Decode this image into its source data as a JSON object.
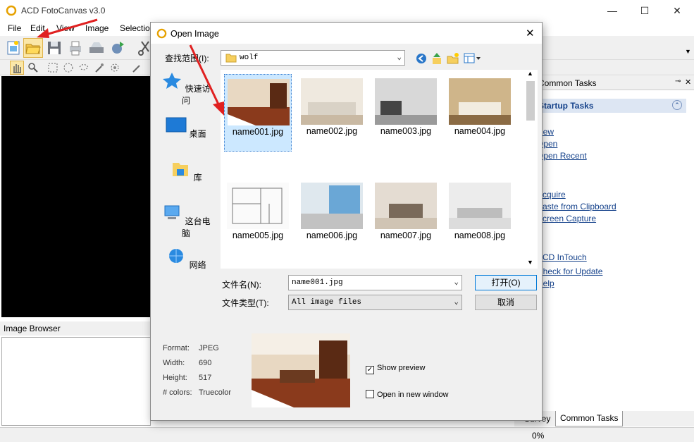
{
  "app": {
    "title": "ACD FotoCanvas v3.0",
    "minimize": "—",
    "maximize": "☐",
    "close": "✕"
  },
  "menu": [
    "File",
    "Edit",
    "View",
    "Image",
    "Selection"
  ],
  "image_browser": {
    "title": "Image Browser"
  },
  "common_tasks": {
    "header": "Common Tasks",
    "group": "Startup Tasks",
    "links": [
      "New",
      "Open",
      "Open Recent",
      "Acquire",
      "Paste from Clipboard",
      "Screen Capture",
      "ACD InTouch",
      "Check for Update",
      "Help"
    ]
  },
  "bottom_tabs": {
    "survey": "Survey",
    "common_tasks": "Common Tasks"
  },
  "status": {
    "progress": "0%"
  },
  "dialog": {
    "title": "Open Image",
    "look_in_label": "查找范围(I):",
    "look_in_value": "wolf",
    "places": [
      "快速访问",
      "桌面",
      "库",
      "这台电脑",
      "网络"
    ],
    "files": [
      "name001.jpg",
      "name002.jpg",
      "name003.jpg",
      "name004.jpg",
      "name005.jpg",
      "name006.jpg",
      "name007.jpg",
      "name008.jpg"
    ],
    "filename_label": "文件名(N):",
    "filename_value": "name001.jpg",
    "filetype_label": "文件类型(T):",
    "filetype_value": "All image files",
    "open_button": "打开(O)",
    "cancel_button": "取消",
    "info": {
      "format_label": "Format:",
      "format": "JPEG",
      "width_label": "Width:",
      "width": "690",
      "height_label": "Height:",
      "height": "517",
      "colors_label": "# colors:",
      "colors": "Truecolor"
    },
    "show_preview": "Show preview",
    "show_preview_checked": true,
    "open_new_window": "Open in new window",
    "open_new_window_checked": false
  },
  "colors": {
    "accent": "#15428b",
    "selection": "#cce8ff",
    "arrow": "#e02020"
  }
}
